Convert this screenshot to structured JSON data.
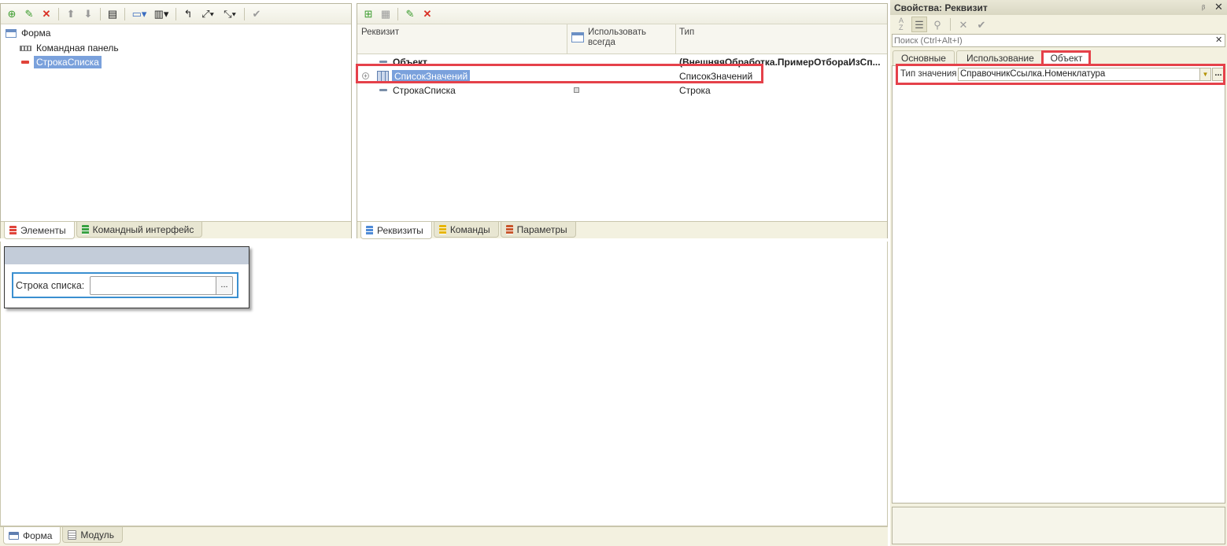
{
  "elements_panel": {
    "tree": [
      {
        "label": "Форма",
        "icon": "form-icon"
      },
      {
        "label": "Командная панель",
        "icon": "command-panel-icon"
      },
      {
        "label": "СтрокаСписка",
        "icon": "field-icon",
        "selected": true
      }
    ],
    "tabs": [
      {
        "label": "Элементы",
        "active": true
      },
      {
        "label": "Командный интерфейс",
        "active": false
      }
    ]
  },
  "attributes_panel": {
    "columns": [
      "Реквизит",
      "Использовать всегда",
      "Тип"
    ],
    "rows": [
      {
        "name": "Объект",
        "type": "(ВнешняяОбработка.ПримерОтбораИзСп...",
        "bold": true
      },
      {
        "name": "СписокЗначений",
        "type": "СписокЗначений",
        "selected": true,
        "expandable": true
      },
      {
        "name": "СтрокаСписка",
        "type": "Строка",
        "use_always": false
      }
    ],
    "tabs": [
      {
        "label": "Реквизиты",
        "active": true
      },
      {
        "label": "Команды",
        "active": false
      },
      {
        "label": "Параметры",
        "active": false
      }
    ]
  },
  "form_preview": {
    "field_label": "Строка списка:",
    "field_value": "",
    "select_button": "..."
  },
  "bottom_tabs": [
    {
      "label": "Форма",
      "active": true
    },
    {
      "label": "Модуль",
      "active": false
    }
  ],
  "properties": {
    "title": "Свойства: Реквизит",
    "pin": "ᵦ",
    "close": "✕",
    "search_placeholder": "Поиск (Ctrl+Alt+I)",
    "search_clear": "✕",
    "tabs": [
      "Основные",
      "Использование",
      "Объект"
    ],
    "active_tab": "Объект",
    "value_type_label": "Тип значения",
    "value_type": "СправочникСсылка.Номенклатура",
    "dropdown_arrow": "▼",
    "more_button": "..."
  },
  "colors": {
    "highlight_red": "#e5414a",
    "selection_blue": "#7aa1dc",
    "panel_border": "#b9b69e",
    "form_header": "#c3ccd9"
  }
}
